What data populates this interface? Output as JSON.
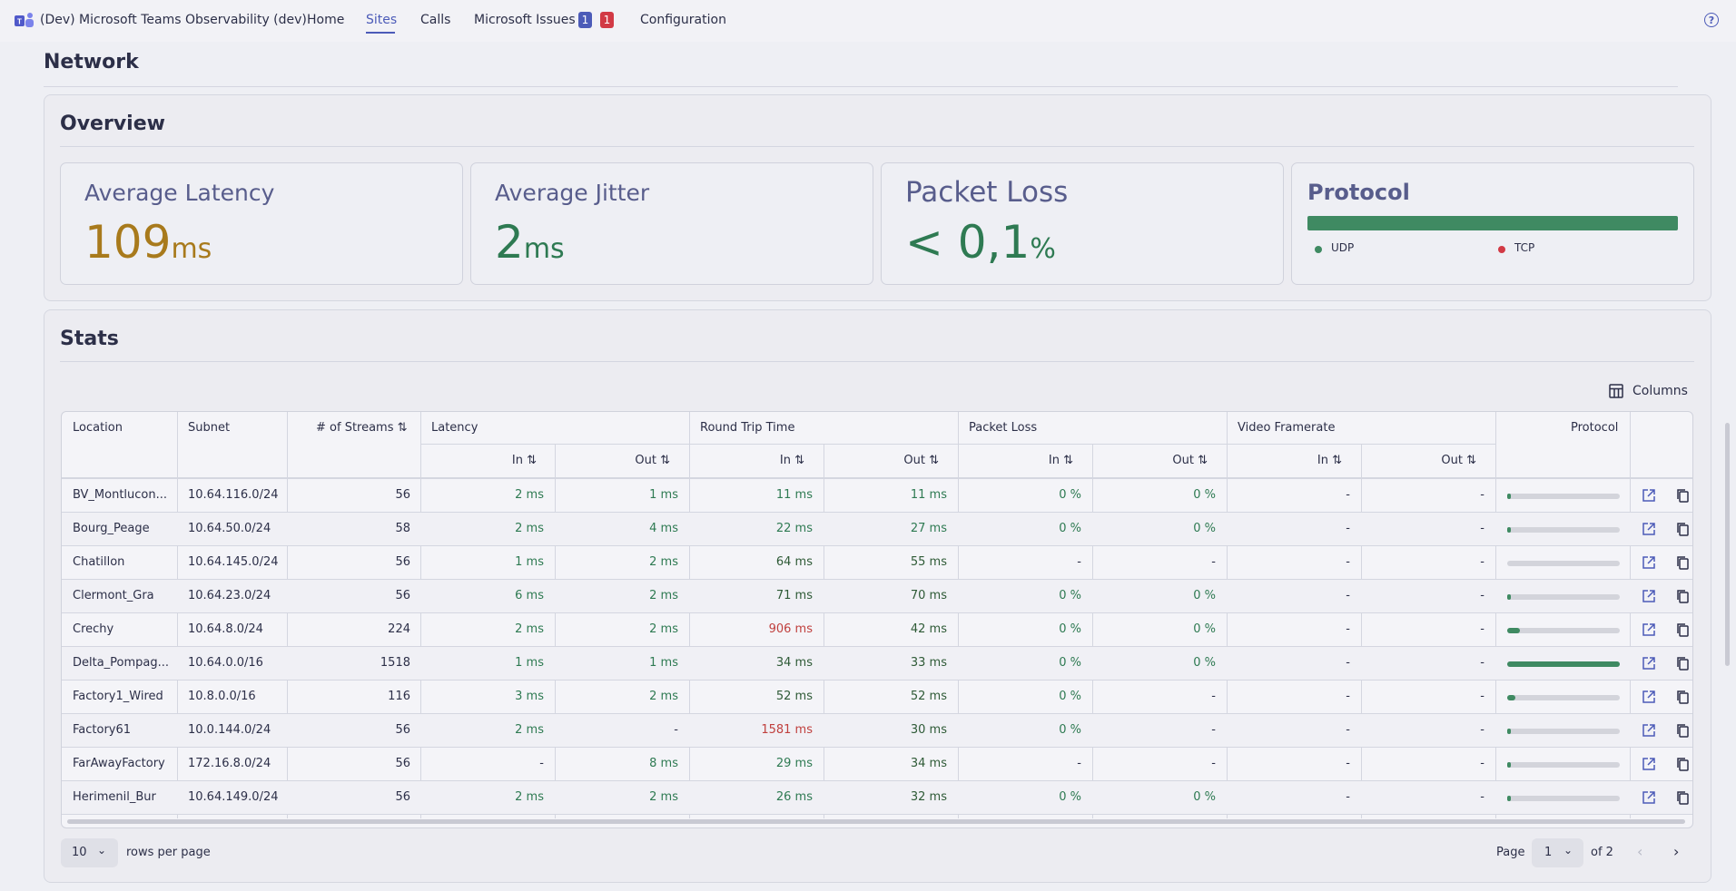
{
  "nav": {
    "app_title": "(Dev) Microsoft Teams Observability (dev)",
    "items": [
      "Home",
      "Sites",
      "Calls",
      "Microsoft Issues",
      "Configuration"
    ],
    "active": "Sites",
    "badges": [
      "1",
      "1"
    ],
    "help": "?"
  },
  "page": {
    "section": "Network"
  },
  "overview": {
    "title": "Overview",
    "latency": {
      "label": "Average Latency",
      "value": "109",
      "unit": "ms"
    },
    "jitter": {
      "label": "Average Jitter",
      "value": "2",
      "unit": "ms"
    },
    "packet_loss": {
      "label": "Packet Loss",
      "value": "< 0,1",
      "unit": "%"
    },
    "protocol": {
      "title": "Protocol",
      "udp_label": "UDP",
      "tcp_label": "TCP",
      "udp_share": 1.0
    }
  },
  "stats": {
    "title": "Stats",
    "columns_button": "Columns",
    "headers": {
      "location": "Location",
      "subnet": "Subnet",
      "streams": "# of Streams",
      "latency": "Latency",
      "rtt": "Round Trip Time",
      "packet_loss": "Packet Loss",
      "video_framerate": "Video Framerate",
      "protocol": "Protocol",
      "in": "In",
      "out": "Out"
    },
    "rows": [
      {
        "location": "BV_Montlucon...",
        "subnet": "10.64.116.0/24",
        "streams": "56",
        "lat_in": "2 ms",
        "lat_out": "1 ms",
        "rtt_in": "11 ms",
        "rtt_out": "11 ms",
        "pl_in": "0 %",
        "pl_out": "0 %",
        "vf_in": "-",
        "vf_out": "-",
        "udp": 0.03
      },
      {
        "location": "Bourg_Peage",
        "subnet": "10.64.50.0/24",
        "streams": "58",
        "lat_in": "2 ms",
        "lat_out": "4 ms",
        "rtt_in": "22 ms",
        "rtt_out": "27 ms",
        "pl_in": "0 %",
        "pl_out": "0 %",
        "vf_in": "-",
        "vf_out": "-",
        "udp": 0.03
      },
      {
        "location": "Chatillon",
        "subnet": "10.64.145.0/24",
        "streams": "56",
        "lat_in": "1 ms",
        "lat_out": "2 ms",
        "rtt_in": "64 ms",
        "rtt_out": "55 ms",
        "pl_in": "-",
        "pl_out": "-",
        "vf_in": "-",
        "vf_out": "-",
        "udp": 0.0
      },
      {
        "location": "Clermont_Gra",
        "subnet": "10.64.23.0/24",
        "streams": "56",
        "lat_in": "6 ms",
        "lat_out": "2 ms",
        "rtt_in": "71 ms",
        "rtt_out": "70 ms",
        "pl_in": "0 %",
        "pl_out": "0 %",
        "vf_in": "-",
        "vf_out": "-",
        "udp": 0.03
      },
      {
        "location": "Crechy",
        "subnet": "10.64.8.0/24",
        "streams": "224",
        "lat_in": "2 ms",
        "lat_out": "2 ms",
        "rtt_in": "906 ms",
        "rtt_out": "42 ms",
        "pl_in": "0 %",
        "pl_out": "0 %",
        "vf_in": "-",
        "vf_out": "-",
        "udp": 0.11
      },
      {
        "location": "Delta_Pompag...",
        "subnet": "10.64.0.0/16",
        "streams": "1518",
        "lat_in": "1 ms",
        "lat_out": "1 ms",
        "rtt_in": "34 ms",
        "rtt_out": "33 ms",
        "pl_in": "0 %",
        "pl_out": "0 %",
        "vf_in": "-",
        "vf_out": "-",
        "udp": 1.0
      },
      {
        "location": "Factory1_Wired",
        "subnet": "10.8.0.0/16",
        "streams": "116",
        "lat_in": "3 ms",
        "lat_out": "2 ms",
        "rtt_in": "52 ms",
        "rtt_out": "52 ms",
        "pl_in": "0 %",
        "pl_out": "-",
        "vf_in": "-",
        "vf_out": "-",
        "udp": 0.07
      },
      {
        "location": "Factory61",
        "subnet": "10.0.144.0/24",
        "streams": "56",
        "lat_in": "2 ms",
        "lat_out": "-",
        "rtt_in": "1581 ms",
        "rtt_out": "30 ms",
        "pl_in": "0 %",
        "pl_out": "-",
        "vf_in": "-",
        "vf_out": "-",
        "udp": 0.03
      },
      {
        "location": "FarAwayFactory",
        "subnet": "172.16.8.0/24",
        "streams": "56",
        "lat_in": "-",
        "lat_out": "8 ms",
        "rtt_in": "29 ms",
        "rtt_out": "34 ms",
        "pl_in": "-",
        "pl_out": "-",
        "vf_in": "-",
        "vf_out": "-",
        "udp": 0.03
      },
      {
        "location": "Herimenil_Bur",
        "subnet": "10.64.149.0/24",
        "streams": "56",
        "lat_in": "2 ms",
        "lat_out": "2 ms",
        "rtt_in": "26 ms",
        "rtt_out": "32 ms",
        "pl_in": "0 %",
        "pl_out": "0 %",
        "vf_in": "-",
        "vf_out": "-",
        "udp": 0.03
      }
    ],
    "pagination": {
      "rows_per_page_value": "10",
      "rows_per_page_label": "rows per page",
      "page_label": "Page",
      "page_value": "1",
      "of_label": "of 2"
    }
  },
  "colors": {
    "accent": "#4c5bb8",
    "latency_warn": "#a87a1c",
    "good": "#2e7a52",
    "bad": "#c0403e",
    "badge_blue": "#4c5bb8",
    "badge_red": "#d23a45",
    "udp": "#3f8a62",
    "tcp": "#d23a45"
  }
}
